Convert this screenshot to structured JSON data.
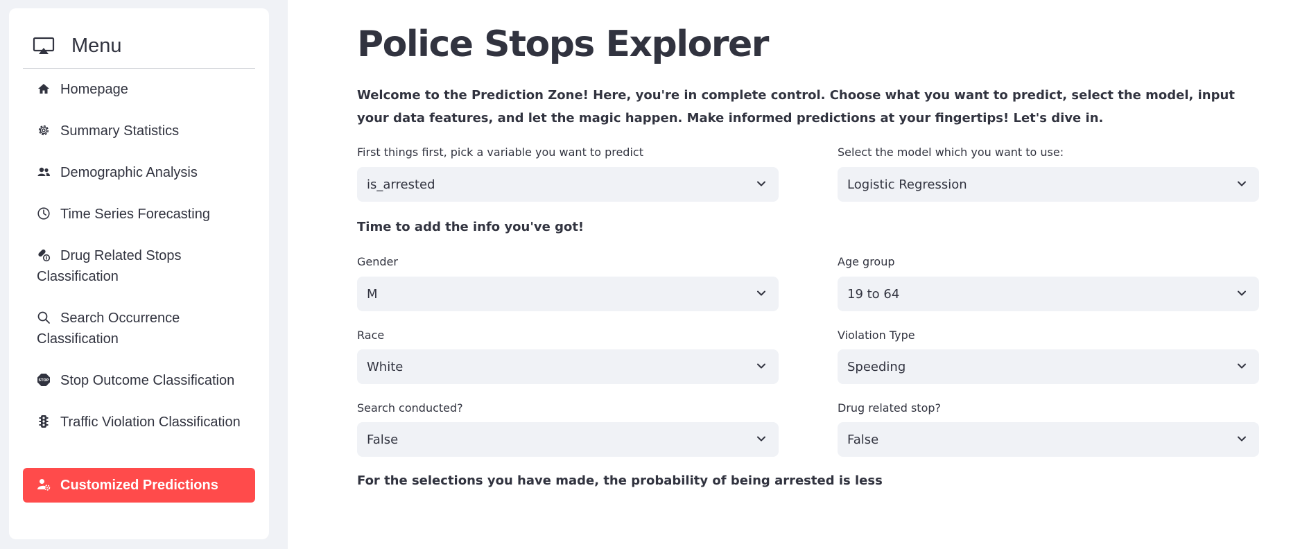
{
  "sidebar": {
    "menu_title": "Menu",
    "items": [
      {
        "label": "Homepage",
        "icon": "house-icon"
      },
      {
        "label": "Summary Statistics",
        "icon": "gear-icon"
      },
      {
        "label": "Demographic Analysis",
        "icon": "people-icon"
      },
      {
        "label": "Time Series Forecasting",
        "icon": "clock-icon"
      },
      {
        "label": "Drug Related Stops Classification",
        "icon": "capsule-icon"
      },
      {
        "label": "Search Occurrence Classification",
        "icon": "search-icon"
      },
      {
        "label": "Stop Outcome Classification",
        "icon": "stop-sign-icon"
      },
      {
        "label": "Traffic Violation Classification",
        "icon": "traffic-light-icon"
      },
      {
        "label": "Customized Predictions",
        "icon": "person-gear-icon",
        "active": true
      }
    ]
  },
  "main": {
    "title": "Police Stops Explorer",
    "intro": "Welcome to the Prediction Zone! Here, you're in complete control. Choose what you want to predict, select the model, input your data features, and let the magic happen. Make informed predictions at your fingertips! Let's dive in.",
    "target": {
      "label": "First things first, pick a variable you want to predict",
      "value": "is_arrested"
    },
    "model": {
      "label": "Select the model which you want to use:",
      "value": "Logistic Regression"
    },
    "info_heading": "Time to add the info you've got!",
    "gender": {
      "label": "Gender",
      "value": "M"
    },
    "age_group": {
      "label": "Age group",
      "value": "19 to 64"
    },
    "race": {
      "label": "Race",
      "value": "White"
    },
    "violation_type": {
      "label": "Violation Type",
      "value": "Speeding"
    },
    "search_conducted": {
      "label": "Search conducted?",
      "value": "False"
    },
    "drug_related": {
      "label": "Drug related stop?",
      "value": "False"
    },
    "result": "For the selections you have made, the probability of being arrested is less"
  },
  "colors": {
    "accent": "#ff4b4b",
    "sidebar_bg": "#f0f2f6",
    "select_bg": "#f0f2f6",
    "text": "#31333f"
  }
}
